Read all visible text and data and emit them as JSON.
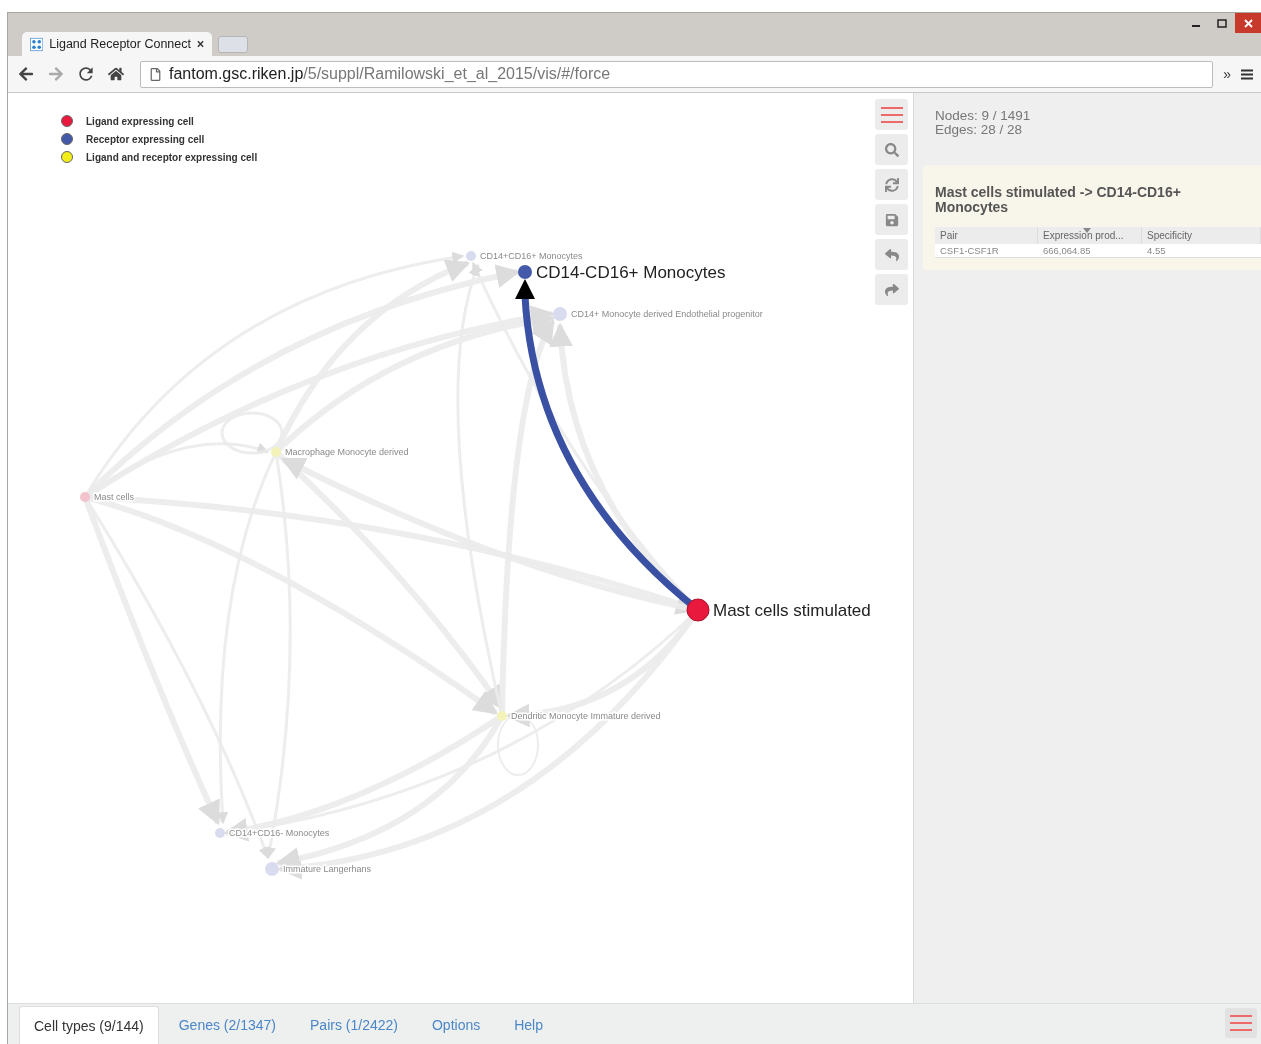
{
  "browser": {
    "tab": {
      "title": "Ligand Receptor Connect",
      "selected": true
    },
    "url_host": "fantom.gsc.riken.jp",
    "url_path": "/5/suppl/Ramilowski_et_al_2015/vis/#/force",
    "overflow": "»"
  },
  "legend": [
    {
      "label": "Ligand expressing cell",
      "color": "#e8193c"
    },
    {
      "label": "Receptor expressing cell",
      "color": "#4459a8"
    },
    {
      "label": "Ligand and receptor expressing cell",
      "color": "#f2ee19"
    }
  ],
  "graph": {
    "nodes": [
      {
        "label": "CD14+CD16+ Monocytes",
        "kind": "receptor",
        "highlighted": false
      },
      {
        "label": "CD14-CD16+ Monocytes",
        "kind": "receptor",
        "highlighted": true
      },
      {
        "label": "CD14+ Monocyte derived Endothelial progenitor",
        "kind": "receptor",
        "highlighted": false
      },
      {
        "label": "Macrophage Monocyte derived",
        "kind": "both",
        "highlighted": false
      },
      {
        "label": "Mast cells",
        "kind": "ligand",
        "highlighted": false
      },
      {
        "label": "Mast cells stimulated",
        "kind": "ligand",
        "highlighted": true
      },
      {
        "label": "Dendritic Monocyte Immature derived",
        "kind": "both",
        "highlighted": false
      },
      {
        "label": "CD14+CD16- Monocytes",
        "kind": "receptor",
        "highlighted": false
      },
      {
        "label": "Immature Langerhans",
        "kind": "receptor",
        "highlighted": false
      }
    ]
  },
  "stats": {
    "nodes": "Nodes: 9 / 1491",
    "edges": "Edges: 28 / 28"
  },
  "detail": {
    "title": "Mast cells stimulated -> CD14-CD16+ Monocytes",
    "columns": [
      {
        "label": "Pair",
        "sorted": false
      },
      {
        "label": "Expression prod...",
        "sorted": true
      },
      {
        "label": "Specificity",
        "sorted": false
      }
    ],
    "rows": [
      [
        "CSF1-CSF1R",
        "666,064.85",
        "4.55"
      ]
    ]
  },
  "bottom_tabs": [
    {
      "label": "Cell types (9/144)",
      "selected": true
    },
    {
      "label": "Genes (2/1347)",
      "selected": false
    },
    {
      "label": "Pairs (1/2422)",
      "selected": false
    },
    {
      "label": "Options",
      "selected": false
    },
    {
      "label": "Help",
      "selected": false
    }
  ]
}
